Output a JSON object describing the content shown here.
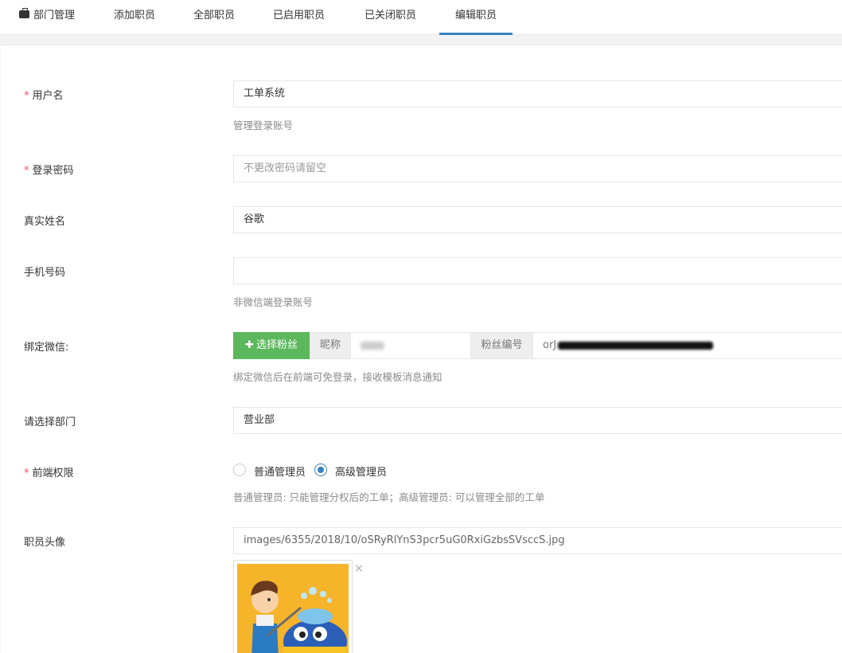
{
  "tabs": [
    {
      "label": "部门管理",
      "icon": "briefcase-icon"
    },
    {
      "label": "添加职员"
    },
    {
      "label": "全部职员"
    },
    {
      "label": "已启用职员"
    },
    {
      "label": "已关闭职员"
    },
    {
      "label": "编辑职员",
      "active": true
    }
  ],
  "form": {
    "username": {
      "label": "用户名",
      "required": "*",
      "value": "工单系统",
      "help": "管理登录账号"
    },
    "password": {
      "label": "登录密码",
      "required": "*",
      "placeholder": "不更改密码请留空"
    },
    "realname": {
      "label": "真实姓名",
      "value": "谷歌"
    },
    "mobile": {
      "label": "手机号码",
      "value": "",
      "help": "非微信端登录账号"
    },
    "wechat": {
      "label": "绑定微信:",
      "button": "选择粉丝",
      "button_icon": "plus-icon",
      "nickname_addon": "昵称",
      "fans_addon": "粉丝编号",
      "fans_prefix": "orJ",
      "help": "绑定微信后在前端可免登录，接收模板消息通知"
    },
    "department": {
      "label": "请选择部门",
      "value": "营业部"
    },
    "permission": {
      "label": "前端权限",
      "required": "*",
      "options": [
        {
          "label": "普通管理员",
          "checked": false
        },
        {
          "label": "高级管理员",
          "checked": true
        }
      ],
      "help": "普通管理员: 只能管理分权后的工单；高级管理员: 可以管理全部的工单"
    },
    "avatar": {
      "label": "职员头像",
      "value": "images/6355/2018/10/oSRyRlYnS3pcr5uG0RxiGzbsSVsccS.jpg",
      "remove": "×"
    }
  },
  "colors": {
    "accent": "#3a81c0",
    "required": "#ed5565",
    "success": "#5cb85c",
    "avatar_bg": "#f6b42b"
  }
}
